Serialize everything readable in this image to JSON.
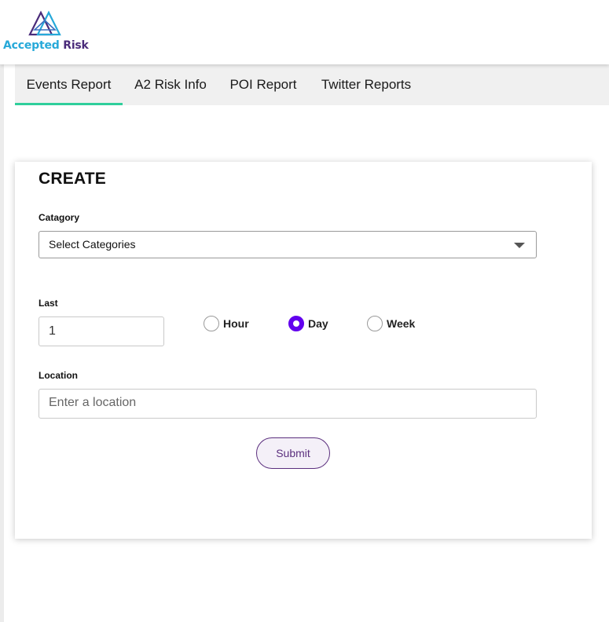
{
  "brand": {
    "name_part1": "Accepted",
    "name_part2": "Risk",
    "color_primary": "#27a9d9",
    "color_secondary": "#4a2b7a"
  },
  "tabs": [
    {
      "label": "Events Report",
      "active": true
    },
    {
      "label": "A2 Risk Info",
      "active": false
    },
    {
      "label": "POI Report",
      "active": false
    },
    {
      "label": "Twitter Reports",
      "active": false
    }
  ],
  "tab_active_color": "#2fcf9b",
  "form": {
    "title": "CREATE",
    "category_label": "Catagory",
    "category_value": "Select Categories",
    "last_label": "Last",
    "last_value": "1",
    "period_options": [
      {
        "label": "Hour",
        "checked": false
      },
      {
        "label": "Day",
        "checked": true
      },
      {
        "label": "Week",
        "checked": false
      }
    ],
    "location_label": "Location",
    "location_placeholder": "Enter a location",
    "submit_label": "Submit",
    "accent_color": "#6200ee"
  }
}
